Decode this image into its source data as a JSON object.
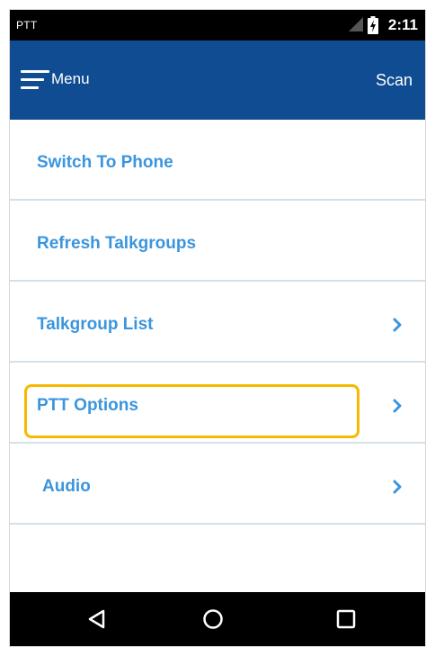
{
  "status_bar": {
    "app_name": "PTT",
    "time": "2:11"
  },
  "toolbar": {
    "menu_label": "Menu",
    "scan_label": "Scan"
  },
  "menu_items": [
    {
      "label": "Switch To Phone",
      "has_chevron": false
    },
    {
      "label": "Refresh Talkgroups",
      "has_chevron": false
    },
    {
      "label": "Talkgroup List",
      "has_chevron": true
    },
    {
      "label": "PTT Options",
      "has_chevron": true,
      "highlighted": true
    },
    {
      "label": "Audio",
      "has_chevron": true
    }
  ],
  "icons": {
    "menu": "hamburger-icon",
    "chevron": "chevron-right-icon",
    "nav_back": "back-triangle-icon",
    "nav_home": "home-circle-icon",
    "nav_recent": "recent-square-icon",
    "signal": "signal-icon",
    "battery": "battery-charging-icon"
  },
  "colors": {
    "status_bar": "#000000",
    "toolbar": "#0f4c91",
    "item_text": "#3b95dd",
    "divider": "#d3e0ea",
    "highlight": "#f6b800",
    "nav_bar": "#000000"
  }
}
